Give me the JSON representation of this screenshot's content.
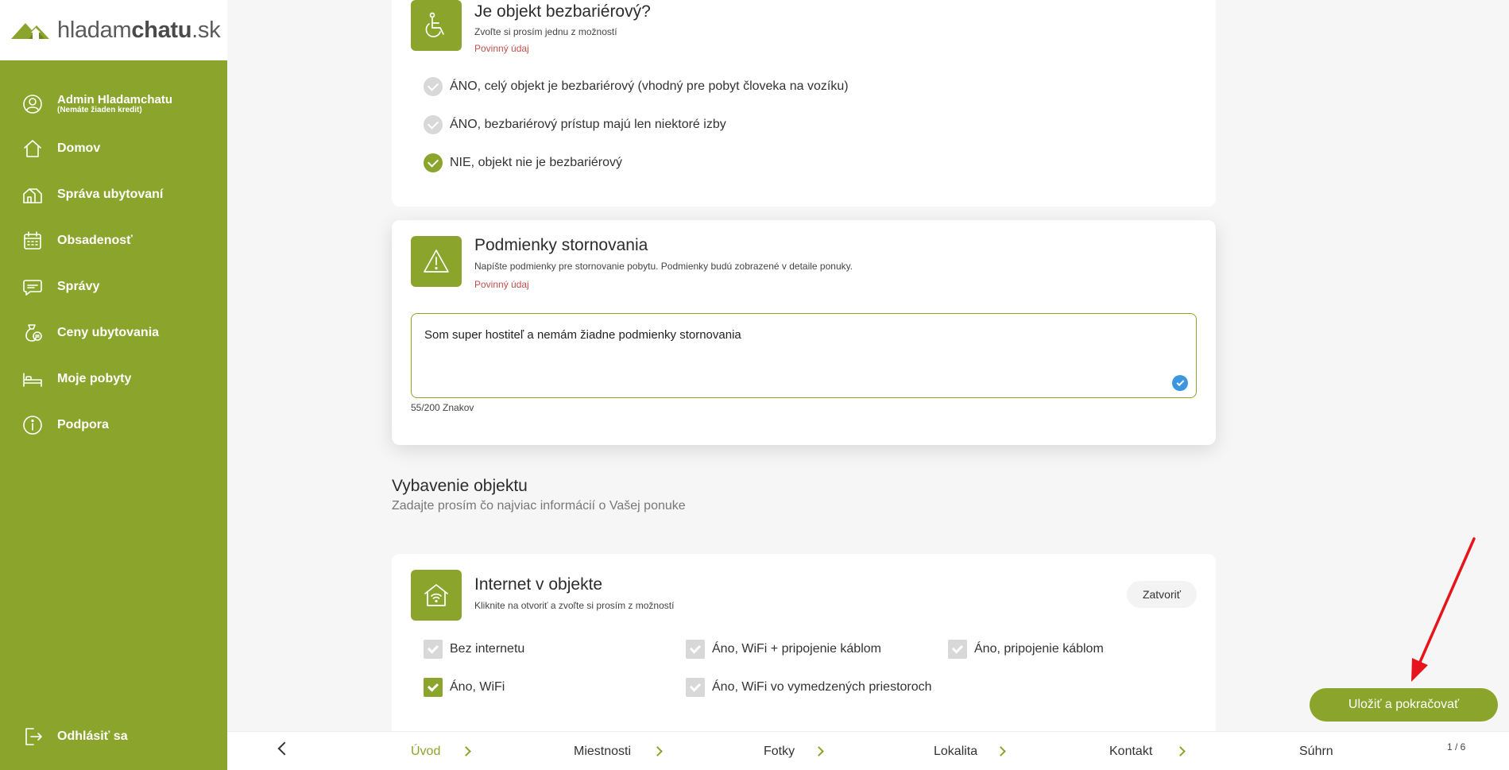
{
  "brand": {
    "logo_part1": "hladam",
    "logo_part2": "chatu",
    "logo_part3": ".sk",
    "accent_color": "#8ba42c"
  },
  "sidebar": {
    "user": {
      "name": "Admin Hladamchatu",
      "credit": "(Nemáte žiaden kredit)",
      "icon": "user-icon"
    },
    "items": [
      {
        "label": "Domov",
        "icon": "home-icon"
      },
      {
        "label": "Správa ubytovaní",
        "icon": "accommodation-icon"
      },
      {
        "label": "Obsadenosť",
        "icon": "calendar-icon"
      },
      {
        "label": "Správy",
        "icon": "message-icon"
      },
      {
        "label": "Ceny ubytovania",
        "icon": "money-icon"
      },
      {
        "label": "Moje pobyty",
        "icon": "bed-icon"
      },
      {
        "label": "Podpora",
        "icon": "info-icon"
      }
    ],
    "logout": {
      "label": "Odhlásiť sa",
      "icon": "logout-icon"
    }
  },
  "barrier_free": {
    "title": "Je objekt bezbariérový?",
    "subtitle": "Zvoľte si prosím jednu z možností",
    "required": "Povinný údaj",
    "icon": "wheelchair-icon",
    "options": [
      {
        "label": "ÁNO, celý objekt je bezbariérový (vhodný pre pobyt človeka na vozíku)",
        "selected": false
      },
      {
        "label": "ÁNO, bezbariérový prístup majú len niektoré izby",
        "selected": false
      },
      {
        "label": "NIE, objekt nie je bezbariérový",
        "selected": true
      }
    ]
  },
  "cancellation": {
    "title": "Podmienky stornovania",
    "subtitle": "Napíšte podmienky pre stornovanie pobytu. Podmienky budú zobrazené v detaile ponuky.",
    "required": "Povinný údaj",
    "icon": "warning-icon",
    "value": "Som super hostiteľ a nemám žiadne podmienky stornovania",
    "counter": "55/200 Znakov"
  },
  "equipment_section": {
    "title": "Vybavenie objektu",
    "subtitle": "Zadajte prosím čo najviac informácií o Vašej ponuke"
  },
  "internet": {
    "title": "Internet v objekte",
    "subtitle": "Kliknite na otvoriť a zvoľte si prosím z možností",
    "close_label": "Zatvoriť",
    "icon": "wifi-house-icon",
    "options": [
      {
        "label": "Bez internetu",
        "checked": false
      },
      {
        "label": "Áno, WiFi + pripojenie káblom",
        "checked": false
      },
      {
        "label": "Áno, pripojenie káblom",
        "checked": false
      },
      {
        "label": "Áno, WiFi",
        "checked": true
      },
      {
        "label": "Áno, WiFi vo vymedzených priestoroch",
        "checked": false
      }
    ]
  },
  "save_button": "Uložiť a pokračovať",
  "steps": [
    "Úvod",
    "Miestnosti",
    "Fotky",
    "Lokalita",
    "Kontakt",
    "Súhrn"
  ],
  "active_step": "Úvod",
  "page_count": "1 / 6",
  "annotation_color": "#e8141c"
}
